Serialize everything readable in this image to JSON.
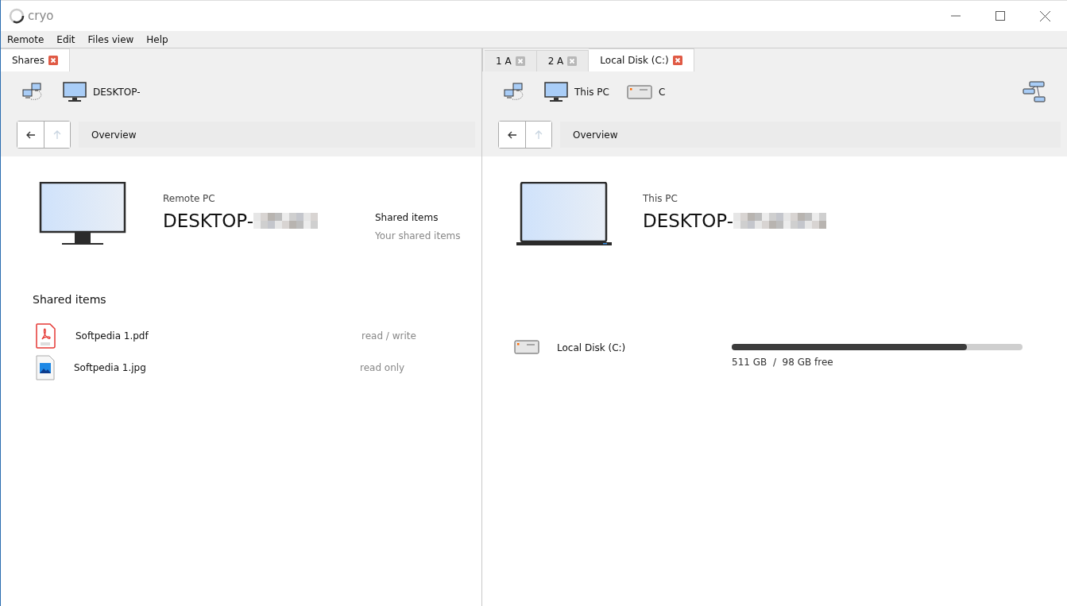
{
  "window": {
    "title": "cryo"
  },
  "menu": [
    "Remote",
    "Edit",
    "Files view",
    "Help"
  ],
  "left_pane": {
    "tabs": [
      {
        "label": "Shares",
        "selected": true
      }
    ],
    "breadcrumb": [
      {
        "kind": "network"
      },
      {
        "kind": "monitor",
        "label": "DESKTOP-"
      }
    ],
    "nav": {
      "buttons": [
        {
          "kind": "back",
          "disabled": false
        },
        {
          "kind": "up",
          "disabled": true
        }
      ],
      "location": "Overview"
    },
    "overview": {
      "kind": "monitor",
      "caption": "Remote PC",
      "name": "DESKTOP-"
    },
    "side_info": {
      "title": "Shared items",
      "subtitle": "Your shared items"
    },
    "section_title": "Shared items",
    "files": [
      {
        "kind": "pdf",
        "name": "Softpedia 1.pdf",
        "access": "read / write"
      },
      {
        "kind": "image",
        "name": "Softpedia 1.jpg",
        "access": "read only"
      }
    ]
  },
  "right_pane": {
    "tabs": [
      {
        "label": "1 A",
        "selected": false
      },
      {
        "label": "2 A",
        "selected": false
      },
      {
        "label": "Local Disk (C:)",
        "selected": true
      }
    ],
    "breadcrumb": [
      {
        "kind": "network"
      },
      {
        "kind": "monitor",
        "label": "This PC"
      },
      {
        "kind": "drive",
        "label": "C"
      }
    ],
    "nav": {
      "buttons": [
        {
          "kind": "back",
          "disabled": false
        },
        {
          "kind": "up",
          "disabled": true
        }
      ],
      "location": "Overview"
    },
    "overview": {
      "kind": "laptop",
      "caption": "This PC",
      "name": "DESKTOP-"
    },
    "drives": [
      {
        "name": "Local Disk (C:)",
        "level": 0.81,
        "reading": "511 GB  /  98 GB free"
      }
    ]
  }
}
